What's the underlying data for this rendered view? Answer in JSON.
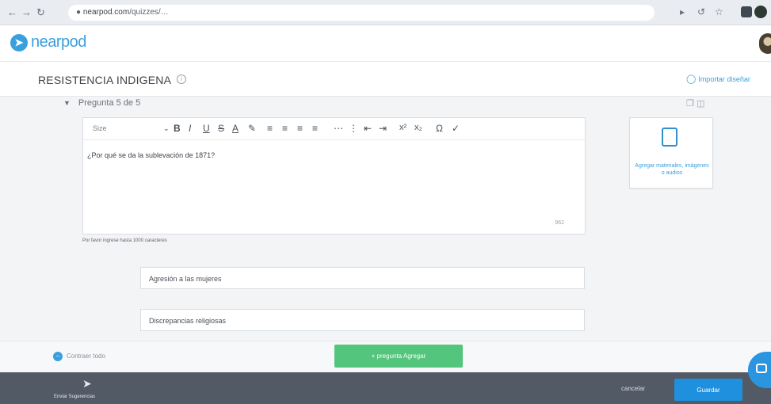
{
  "browser": {
    "url_host": "nearpod.com",
    "url_rest": "/quizzes/…"
  },
  "header": {
    "logo_text": "nearpod"
  },
  "lesson": {
    "title": "RESISTENCIA INDIGENA",
    "import_label": "Importar diseñar"
  },
  "question": {
    "header": "Pregunta 5 de 5",
    "font_size_label": "Size",
    "prompt_text": "¿Por qué se da la sublevación de 1871?",
    "char_count": "962",
    "hint": "Por favor ingrese hasta 1000 caracteres",
    "media_label": "Agregar materiales, imágenes o audios"
  },
  "answers": [
    {
      "text": "Agresión a las mujeres"
    },
    {
      "text": "Discrepancias religiosas"
    }
  ],
  "actions": {
    "collapse_label": "Contraer todo",
    "add_question": "+ pregunta Agregar"
  },
  "footer": {
    "send_label": "Enviar Sugerencias",
    "cancel_label": "cancelar",
    "save_label": "Guardar"
  },
  "colors": {
    "brand": "#3aa0dd",
    "add_button": "#54c57c",
    "save_button": "#1e90dd",
    "footer_bg": "#525a66"
  }
}
